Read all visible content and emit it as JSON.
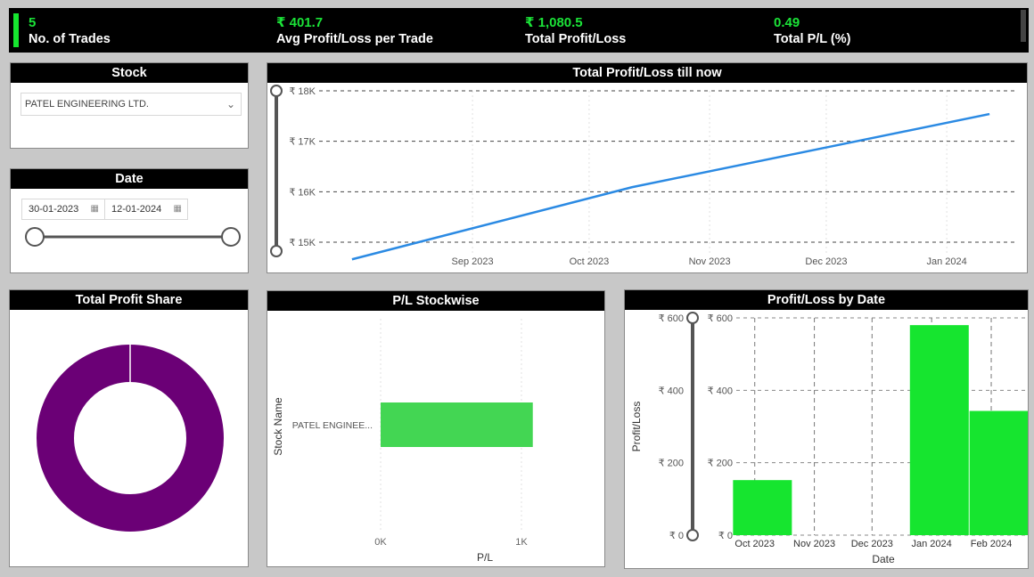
{
  "kpis": [
    {
      "value": "5",
      "label": "No. of Trades"
    },
    {
      "value": "₹ 401.7",
      "label": "Avg Profit/Loss per Trade"
    },
    {
      "value": "₹ 1,080.5",
      "label": "Total Profit/Loss"
    },
    {
      "value": "0.49",
      "label": "Total P/L (%)"
    }
  ],
  "stock_filter": {
    "title": "Stock",
    "selected": "PATEL ENGINEERING LTD."
  },
  "date_filter": {
    "title": "Date",
    "start": "30-01-2023",
    "end": "12-01-2024"
  },
  "colors": {
    "accent_green": "#16e52f",
    "line_blue": "#2b8ae3",
    "donut_purple": "#6b0076",
    "bar_green_light": "#43d653"
  },
  "chart_data": [
    {
      "type": "line",
      "title": "Total Profit/Loss till now",
      "x": [
        "Sep 2023",
        "Oct 2023",
        "Nov 2023",
        "Dec 2023",
        "Jan 2024"
      ],
      "x_ticks": [
        "Sep 2023",
        "Oct 2023",
        "Nov 2023",
        "Dec 2023",
        "Jan 2024"
      ],
      "y_ticks": [
        "₹ 18K",
        "₹ 17K",
        "₹ 16K",
        "₹ 15K"
      ],
      "ylim": [
        14700,
        18000
      ],
      "series": [
        {
          "points": [
            [
              "2023-08-01",
              14660
            ],
            [
              "2023-10-12",
              16090
            ],
            [
              "2024-01-12",
              17540
            ]
          ]
        }
      ],
      "grid": true
    },
    {
      "type": "pie",
      "title": "Total Profit Share",
      "slices": [
        {
          "label": "PATEL ENGINEERING LTD.",
          "value": 100,
          "color": "#6b0076"
        }
      ]
    },
    {
      "type": "bar",
      "title": "P/L Stockwise",
      "orientation": "horizontal",
      "categories": [
        "PATEL ENGINEE..."
      ],
      "values": [
        1080.5
      ],
      "xlabel": "P/L",
      "ylabel": "Stock Name",
      "x_ticks": [
        "0K",
        "1K"
      ],
      "xlim": [
        0,
        1000
      ]
    },
    {
      "type": "bar",
      "title": "Profit/Loss by Date",
      "categories": [
        "Oct 2023",
        "Nov 2023",
        "Dec 2023",
        "Jan 2024",
        "Feb 2024"
      ],
      "values": [
        152,
        0,
        580,
        343,
        0
      ],
      "bar_positions_days": [
        {
          "x": "2023-10-05",
          "value": 152
        },
        {
          "x": "2024-01-05",
          "value": 580
        },
        {
          "x": "2024-02-05",
          "value": 343
        }
      ],
      "xlabel": "Date",
      "ylabel": "Profit/Loss",
      "y_ticks": [
        "₹ 600",
        "₹ 400",
        "₹ 200",
        "₹ 0"
      ],
      "ylim": [
        0,
        600
      ],
      "grid": true
    }
  ]
}
